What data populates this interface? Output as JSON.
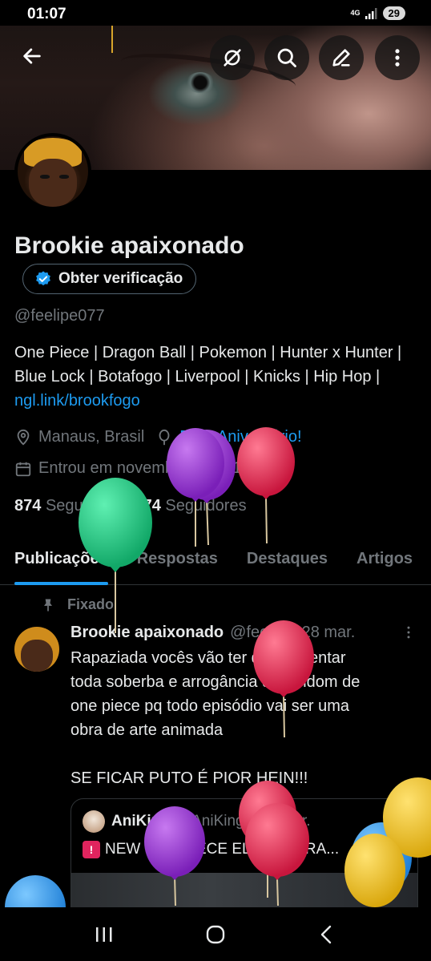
{
  "status_bar": {
    "time": "01:07",
    "network": "4G",
    "battery": "29"
  },
  "header": {
    "icons": [
      "back-arrow-icon",
      "grok-slash-icon",
      "search-icon",
      "edit-pen-icon",
      "more-vertical-icon"
    ]
  },
  "profile": {
    "name": "Brookie apaixonado",
    "verify_label": "Obter verificação",
    "handle": "@feelipe077",
    "bio_text": "One Piece | Dragon Ball | Pokemon | Hunter x Hunter | Blue Lock | Botafogo | Liverpool | Knicks | Hip Hop |",
    "bio_link": "ngl.link/brookfogo",
    "location": "Manaus, Brasil",
    "birthday": "Feliz Aniversário!",
    "joined": "Entrou em novembro de 2015",
    "following_count": "874",
    "following_label": "Seguindo",
    "followers_count": "474",
    "followers_label": "Seguidores"
  },
  "tabs": [
    "Publicações",
    "Respostas",
    "Destaques",
    "Artigos"
  ],
  "pinned_post": {
    "pinned_label": "Fixado",
    "author": "Brookie apaixonado",
    "handle": "@feel...",
    "date": "· 28 mar.",
    "text_lines": [
      "Rapaziada vocês vão ter que aguentar",
      "toda soberba e arrogância da fandom de",
      "one piece pq todo episódio vai ser uma",
      "obra de arte animada",
      "",
      "SE FICAR PUTO É PIOR HEIN!!!"
    ],
    "quote": {
      "author": "AniKing",
      "handle": "@AniKing",
      "date": "· 23 mar.",
      "text": "NEW ONE PIECE ELBAPH TRA..."
    }
  },
  "colors": {
    "accent": "#1d9bf0",
    "muted": "#71767b",
    "text": "#e7e9ea",
    "background": "#000000"
  }
}
